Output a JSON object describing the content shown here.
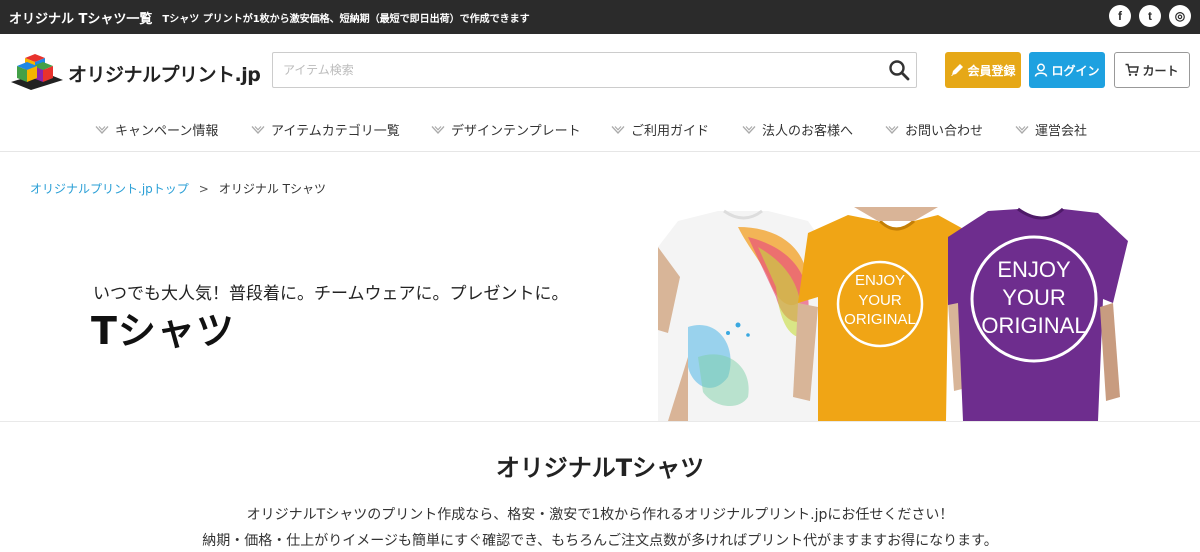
{
  "topbar": {
    "title": "オリジナル Tシャツ一覧",
    "description": "Tシャツ プリントが1枚から激安価格、短納期（最短で即日出荷）で作成できます",
    "social": [
      {
        "icon": "facebook-icon",
        "glyph": "f"
      },
      {
        "icon": "twitter-icon",
        "glyph": "t"
      },
      {
        "icon": "instagram-icon",
        "glyph": "◎"
      }
    ]
  },
  "header": {
    "logo_text": "オリジナルプリント.jp",
    "search": {
      "placeholder": "アイテム検索",
      "value": ""
    },
    "register_label": "会員登録",
    "login_label": "ログイン",
    "cart_label": "カート"
  },
  "nav": {
    "items": [
      {
        "label": "キャンペーン情報"
      },
      {
        "label": "アイテムカテゴリ一覧"
      },
      {
        "label": "デザインテンプレート"
      },
      {
        "label": "ご利用ガイド"
      },
      {
        "label": "法人のお客様へ"
      },
      {
        "label": "お問い合わせ"
      },
      {
        "label": "運営会社"
      }
    ]
  },
  "breadcrumb": {
    "home": "オリジナルプリント.jpトップ",
    "separator": ">",
    "current": "オリジナル Tシャツ"
  },
  "hero": {
    "subtitle": "いつでも大人気！普段着に。チームウェアに。プレゼントに。",
    "title": "Tシャツ",
    "shirt_print": [
      "ENJOY",
      "YOUR",
      "ORIGINAL"
    ]
  },
  "intro": {
    "title": "オリジナルTシャツ",
    "line1": "オリジナルTシャツのプリント作成なら、格安・激安で1枚から作れるオリジナルプリント.jpにお任せください！",
    "line2": "納期・価格・仕上がりイメージも簡単にすぐ確認でき、もちろんご注文点数が多ければプリント代がますますお得になります。"
  },
  "colors": {
    "topbar": "#2b2b2b",
    "register": "#e6a817",
    "login": "#1ea1e0",
    "link": "#2a9fd6",
    "shirt_yellow": "#f0a515",
    "shirt_purple": "#6e2d8e"
  }
}
